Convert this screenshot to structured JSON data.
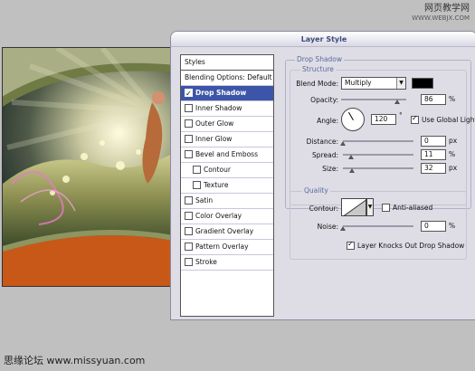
{
  "watermark": {
    "top_line1": "网页教学网",
    "top_line2": "WWW.WEBJX.COM",
    "bottom": "思缘论坛 www.missyuan.com"
  },
  "dialog": {
    "title": "Layer Style",
    "styles_list": [
      {
        "label": "Styles",
        "kind": "header",
        "checked": false
      },
      {
        "label": "Blending Options: Default",
        "kind": "item",
        "checked": false
      },
      {
        "label": "Drop Shadow",
        "kind": "check",
        "checked": true,
        "selected": true
      },
      {
        "label": "Inner Shadow",
        "kind": "check",
        "checked": false
      },
      {
        "label": "Outer Glow",
        "kind": "check",
        "checked": false
      },
      {
        "label": "Inner Glow",
        "kind": "check",
        "checked": false
      },
      {
        "label": "Bevel and Emboss",
        "kind": "check",
        "checked": false
      },
      {
        "label": "Contour",
        "kind": "subcheck",
        "checked": false
      },
      {
        "label": "Texture",
        "kind": "subcheck",
        "checked": false
      },
      {
        "label": "Satin",
        "kind": "check",
        "checked": false
      },
      {
        "label": "Color Overlay",
        "kind": "check",
        "checked": false
      },
      {
        "label": "Gradient Overlay",
        "kind": "check",
        "checked": false
      },
      {
        "label": "Pattern Overlay",
        "kind": "check",
        "checked": false
      },
      {
        "label": "Stroke",
        "kind": "check",
        "checked": false
      }
    ],
    "drop_shadow": {
      "section_title": "Drop Shadow",
      "structure_title": "Structure",
      "blend_mode_label": "Blend Mode:",
      "blend_mode_value": "Multiply",
      "shadow_color": "#000000",
      "opacity_label": "Opacity:",
      "opacity_value": "86",
      "opacity_unit": "%",
      "opacity_fraction": 0.86,
      "angle_label": "Angle:",
      "angle_value": "120",
      "angle_unit": "°",
      "use_global_light_label": "Use Global Light",
      "use_global_light_checked": true,
      "distance_label": "Distance:",
      "distance_value": "0",
      "distance_unit": "px",
      "distance_fraction": 0.0,
      "spread_label": "Spread:",
      "spread_value": "11",
      "spread_unit": "%",
      "spread_fraction": 0.11,
      "size_label": "Size:",
      "size_value": "32",
      "size_unit": "px",
      "size_fraction": 0.128,
      "quality_title": "Quality",
      "contour_label": "Contour:",
      "anti_aliased_label": "Anti-aliased",
      "anti_aliased_checked": false,
      "noise_label": "Noise:",
      "noise_value": "0",
      "noise_unit": "%",
      "noise_fraction": 0.0,
      "knockout_label": "Layer Knocks Out Drop Shadow",
      "knockout_checked": true
    }
  }
}
